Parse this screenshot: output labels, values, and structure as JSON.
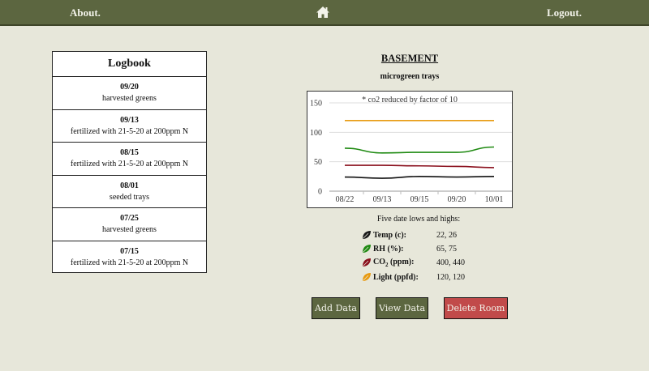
{
  "nav": {
    "about_label": "About.",
    "logout_label": "Logout.",
    "home_icon": "home-icon"
  },
  "logbook": {
    "title": "Logbook",
    "entries": [
      {
        "date": "09/20",
        "text": "harvested greens"
      },
      {
        "date": "09/13",
        "text": "fertilized with 21-5-20 at 200ppm N"
      },
      {
        "date": "08/15",
        "text": "fertilized with 21-5-20 at 200ppm N"
      },
      {
        "date": "08/01",
        "text": "seeded trays"
      },
      {
        "date": "07/25",
        "text": "harvested greens"
      },
      {
        "date": "07/15",
        "text": "fertilized with 21-5-20 at 200ppm N"
      }
    ]
  },
  "room": {
    "name": "BASEMENT",
    "subtitle": "microgreen trays"
  },
  "chart_data": {
    "type": "line",
    "annotation": "* co2 reduced by factor of 10",
    "categories": [
      "08/22",
      "09/13",
      "09/15",
      "09/20",
      "10/01"
    ],
    "ylim": [
      0,
      150
    ],
    "yticks": [
      0,
      50,
      100,
      150
    ],
    "grid": true,
    "series": [
      {
        "color": "#e89a10",
        "values": [
          120,
          120,
          120,
          120,
          120
        ]
      },
      {
        "color": "#1f8a12",
        "values": [
          73,
          65,
          66,
          66,
          75
        ]
      },
      {
        "color": "#8a0f1c",
        "values": [
          44,
          44,
          43,
          42,
          40
        ]
      },
      {
        "color": "#111111",
        "values": [
          24,
          22,
          25,
          24,
          25
        ]
      }
    ]
  },
  "summary": {
    "heading": "Five date lows and highs:",
    "rows": [
      {
        "label": "Temp (c):",
        "value": "22, 26",
        "color": "#1a1a1a"
      },
      {
        "label": "RH (%):",
        "value": "65, 75",
        "color": "#1f8a12"
      },
      {
        "label_main": "CO",
        "label_sub": "2",
        "label_rest": " (ppm):",
        "value": "400, 440",
        "color": "#8a0f1c"
      },
      {
        "label": "Light (ppfd):",
        "value": "120, 120",
        "color": "#e89a10"
      }
    ]
  },
  "buttons": {
    "add": "Add Data",
    "view": "View Data",
    "delete": "Delete Room"
  }
}
